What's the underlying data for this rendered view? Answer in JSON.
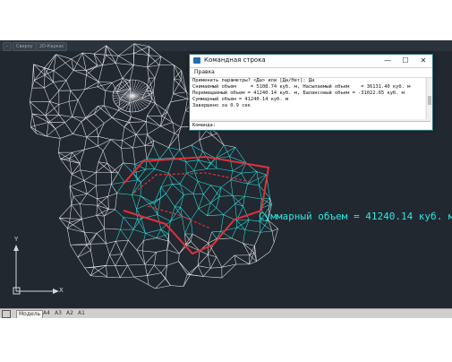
{
  "viewport": {
    "chips": [
      "-",
      "Сверху",
      "2D-Каркас"
    ],
    "result_label": "Суммарный объем = 41240.14 куб. м",
    "ucs": {
      "x_label": "X",
      "y_label": "Y"
    }
  },
  "status_tabs": [
    "Модель",
    "A4",
    "A3",
    "A2",
    "A1"
  ],
  "active_tab": "Модель",
  "command_window": {
    "title": "Командная строка",
    "controls": {
      "minimize": "—",
      "maximize": "☐",
      "close": "✕"
    },
    "menu": "Правка",
    "lines": [
      "Применить параметры? <Да> или [Да/Нет]: Да",
      "Снимаемый объем     = 5108.74 куб. м, Насыпаемый объем    = 36131.40 куб. м",
      "Перемещаемый объем = 41240.14 куб. м, Балансовый объем = -31022.65 куб. м",
      "Суммарный объем = 41240.14 куб. м",
      "",
      "Завершено за 0.9 сек"
    ],
    "prompt": "Команда:"
  },
  "colors": {
    "background": "#212830",
    "mesh": "#e8e8e8",
    "cut": "#2fe4e0",
    "boundary": "#e0303a"
  }
}
